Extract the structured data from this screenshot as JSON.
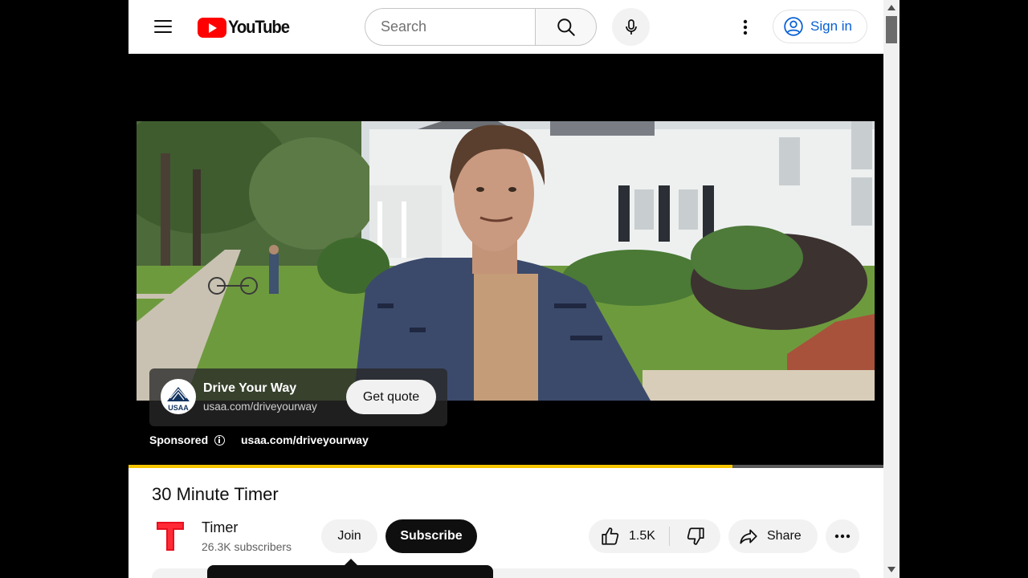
{
  "header": {
    "logo_text": "YouTube",
    "search_placeholder": "Search",
    "sign_in_label": "Sign in"
  },
  "ad": {
    "title": "Drive Your Way",
    "url": "usaa.com/driveyourway",
    "cta_label": "Get quote",
    "logo_text": "USAA",
    "sponsored_label": "Sponsored",
    "sponsored_url": "usaa.com/driveyourway",
    "progress_fraction": 0.8
  },
  "video": {
    "title": "30 Minute Timer"
  },
  "channel": {
    "name": "Timer",
    "subscribers": "26.3K subscribers",
    "join_label": "Join",
    "subscribe_label": "Subscribe"
  },
  "actions": {
    "like_count": "1.5K",
    "share_label": "Share"
  },
  "colors": {
    "brand_red": "#ff0000",
    "link_blue": "#065fd4",
    "progress_yellow": "#f6c500"
  },
  "icons": [
    "menu-icon",
    "search-icon",
    "mic-icon",
    "kebab-icon",
    "account-icon",
    "info-icon",
    "like-icon",
    "dislike-icon",
    "share-icon",
    "more-icon"
  ]
}
